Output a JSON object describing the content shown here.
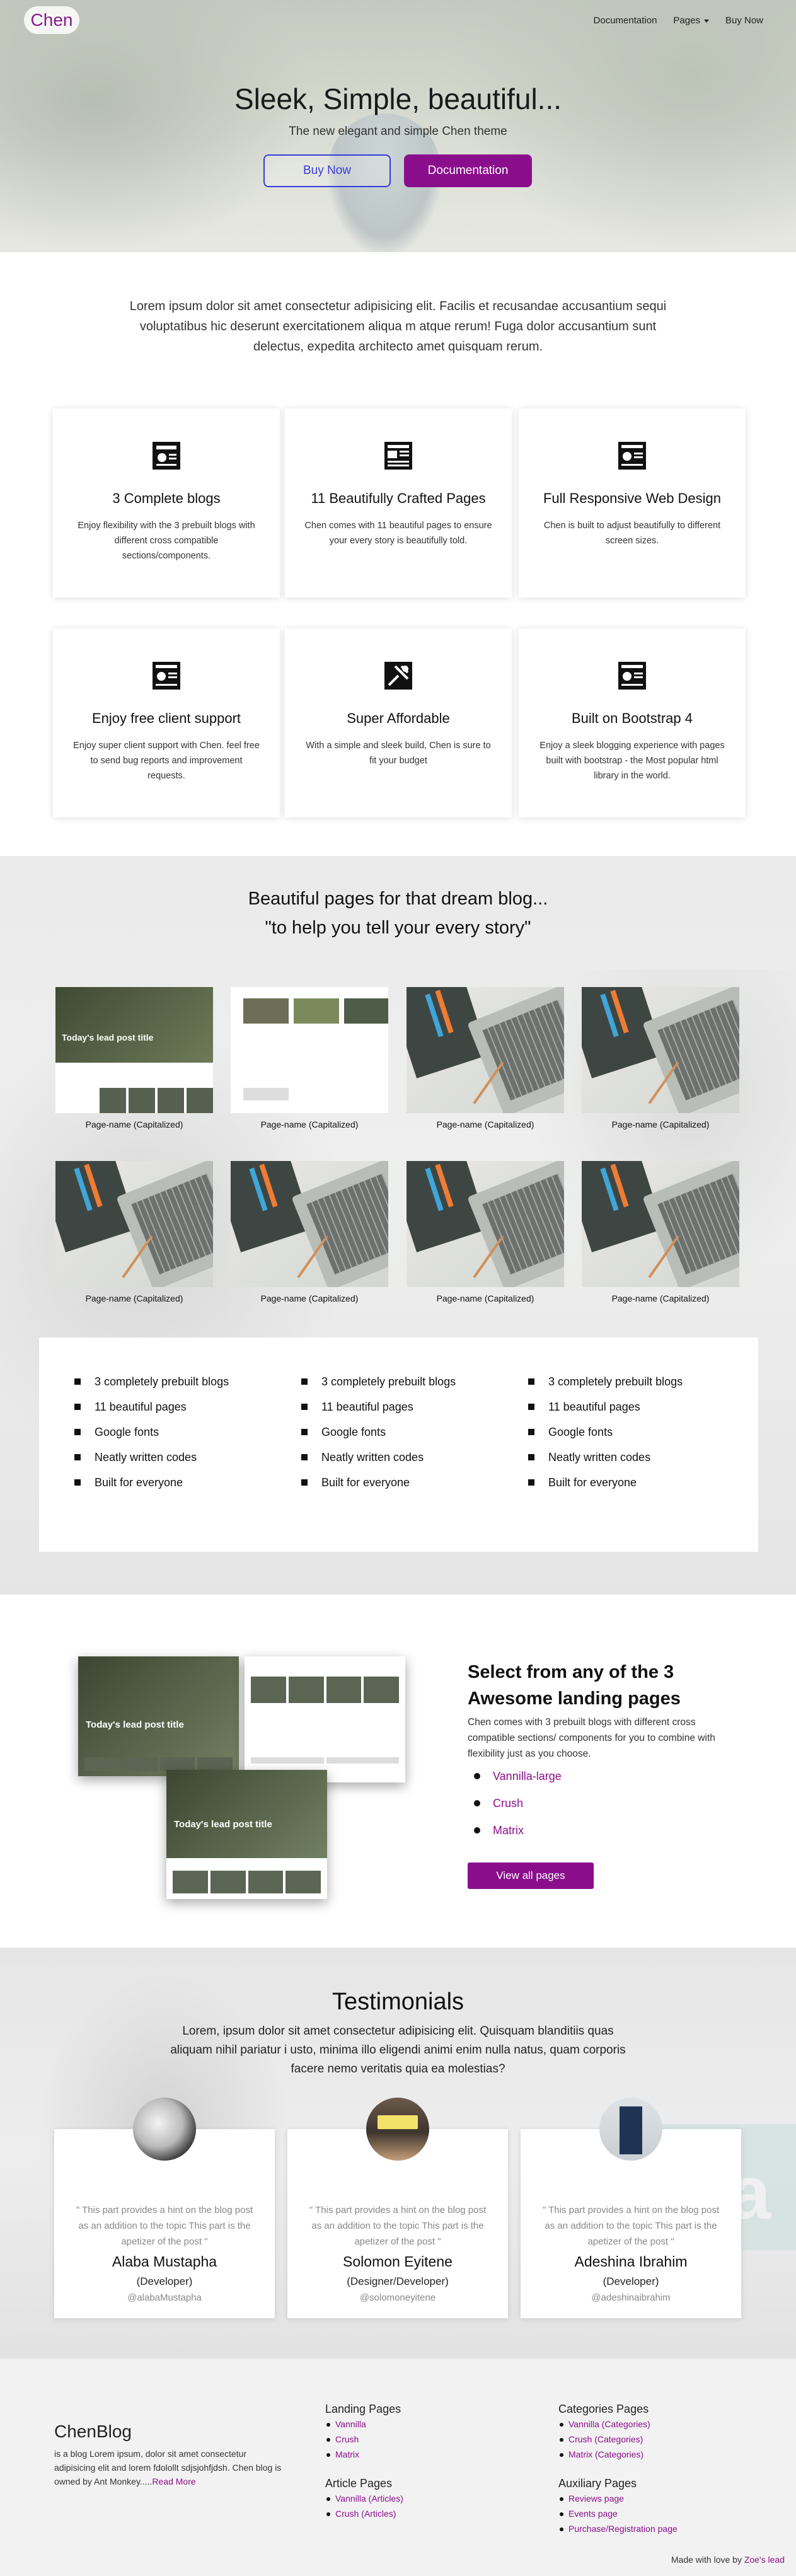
{
  "nav": {
    "brand": "Chen",
    "documentation": "Documentation",
    "pages": "Pages",
    "buy_now": "Buy Now"
  },
  "hero": {
    "title": "Sleek, Simple, beautiful...",
    "subtitle": "The new elegant and simple Chen theme",
    "buy_now": "Buy Now",
    "documentation": "Documentation"
  },
  "intro": "Lorem ipsum dolor sit amet consectetur adipisicing elit. Facilis et recusandae accusantium sequi voluptatibus hic deserunt exercitationem aliqua m atque rerum! Fuga dolor accusantium sunt delectus, expedita architecto amet quisquam rerum.",
  "features": [
    {
      "title": "3 Complete blogs",
      "text": "Enjoy flexibility with the 3 prebuilt blogs with different cross compatible sections/components."
    },
    {
      "title": "11 Beautifully Crafted Pages",
      "text": "Chen comes with 11 beautiful pages to ensure your every story is beautifully told."
    },
    {
      "title": "Full Responsive Web Design",
      "text": "Chen is built to adjust beautifully to different screen sizes."
    },
    {
      "title": "Enjoy free client support",
      "text": "Enjoy super client support with Chen. feel free to send bug reports and improvement requests."
    },
    {
      "title": "Super Affordable",
      "text": "With a simple and sleek build, Chen is sure to fit your budget"
    },
    {
      "title": "Built on Bootstrap 4",
      "text": "Enjoy a sleek blogging experience with pages built with bootstrap - the Most popular html library in the world."
    }
  ],
  "pages_section": {
    "heading1": "Beautiful pages for that dream blog...",
    "heading2": "\"to help you tell your every story\"",
    "blog_thumb_title": "Today's lead post title",
    "captions": [
      "Page-name (Capitalized)",
      "Page-name (Capitalized)",
      "Page-name (Capitalized)",
      "Page-name (Capitalized)",
      "Page-name (Capitalized)",
      "Page-name (Capitalized)",
      "Page-name (Capitalized)",
      "Page-name (Capitalized)"
    ]
  },
  "feature_lists": [
    [
      "3 completely prebuilt blogs",
      "11 beautiful pages",
      "Google fonts",
      "Neatly written codes",
      "Built for everyone"
    ],
    [
      "3 completely prebuilt blogs",
      "11 beautiful pages",
      "Google fonts",
      "Neatly written codes",
      "Built for everyone"
    ],
    [
      "3 completely prebuilt blogs",
      "11 beautiful pages",
      "Google fonts",
      "Neatly written codes",
      "Built for everyone"
    ]
  ],
  "landing": {
    "mock_title": "Today's lead post title",
    "heading": "Select from any of the 3 Awesome landing pages",
    "text": "Chen comes with 3 prebuilt blogs with different cross compatible sections/ components for you to combine with flexibility just as you choose.",
    "items": [
      "Vannilla-large",
      "Crush",
      "Matrix"
    ],
    "button": "View all pages"
  },
  "testimonials": {
    "heading": "Testimonials",
    "text": "Lorem, ipsum dolor sit amet consectetur adipisicing elit. Quisquam blanditiis quas aliquam nihil pariatur i usto, minima illo eligendi animi enim nulla natus, quam corporis facere nemo veritatis quia ea molestias?",
    "cards": [
      {
        "quote": "\" This part provides a hint on the blog post as an addition to the topic This part is the apetizer of the post \"",
        "name": "Alaba Mustapha",
        "role": "(Developer)",
        "handle": "@alabaMustapha"
      },
      {
        "quote": "\" This part provides a hint on the blog post as an addition to the topic This part is the apetizer of the post \"",
        "name": "Solomon Eyitene",
        "role": "(Designer/Developer)",
        "handle": "@solomoneyitene"
      },
      {
        "quote": "\" This part provides a hint on the blog post as an addition to the topic This part is the apetizer of the post \"",
        "name": "Adeshina Ibrahim",
        "role": "(Developer)",
        "handle": "@adeshinaibrahim"
      }
    ]
  },
  "footer": {
    "brand": "ChenBlog",
    "desc": "is a blog Lorem ipsum, dolor sit amet consectetur adipisicing elit and lorem fdolollt sdjsjohfjdsh. Chen blog is owned by Ant Monkey.....",
    "read_more": "Read More",
    "landing_title": "Landing Pages",
    "landing_links": [
      "Vannilla",
      "Crush",
      "Matrix"
    ],
    "article_title": "Article Pages",
    "article_links": [
      "Vannilla (Articles)",
      "Crush (Articles)"
    ],
    "categories_title": "Categories Pages",
    "categories_links": [
      "Vannilla (Categories)",
      "Crush (Categories)",
      "Matrix (Categories)"
    ],
    "aux_title": "Auxiliary Pages",
    "aux_links": [
      "Reviews page",
      "Events page",
      "Purchase/Registration page"
    ],
    "credit_prefix": "Made with love by ",
    "credit_link": "Zoe's lead"
  },
  "colors": {
    "accent": "#8a0e8c",
    "outline": "#3b3ad9"
  }
}
